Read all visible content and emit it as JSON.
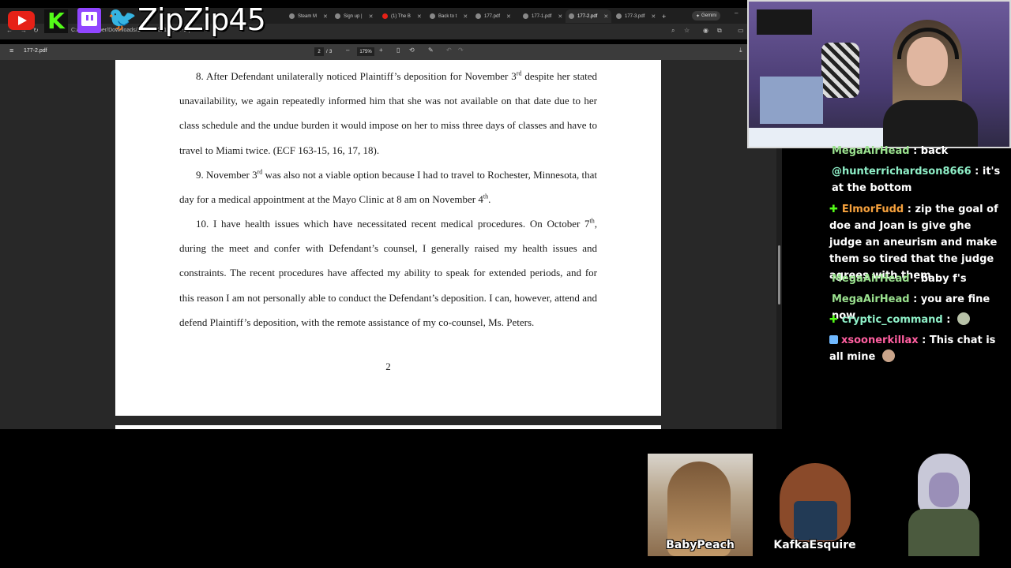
{
  "browser": {
    "tabs": [
      {
        "label": "Steam M"
      },
      {
        "label": "Sign up |"
      },
      {
        "label": "(1) The B"
      },
      {
        "label": "Back to t"
      },
      {
        "label": "177.pdf"
      },
      {
        "label": "177-1.pdf"
      },
      {
        "label": "177-2.pdf"
      },
      {
        "label": "177-3.pdf"
      }
    ],
    "new_tab": "+",
    "gemini_label": "Gemini",
    "url": "C:/Users/tober/Downloads/1-25-cv-201.../177-2.pdf"
  },
  "pdf": {
    "file_name": "177-2.pdf",
    "current_page": "2",
    "page_separator": "/",
    "total_pages": "3",
    "zoom": "175%",
    "zoom_minus": "–",
    "zoom_plus": "+",
    "page_number_footer": "2",
    "paragraphs": {
      "p8_a": "8.  After Defendant unilaterally noticed Plaintiff’s deposition for November 3",
      "p8_sup": "rd",
      "p8_b": " despite her stated unavailability, we again repeatedly informed him that she was not available on that date due to her class schedule and the undue burden it would impose on her to miss three days of classes and have to travel to Miami twice. (ECF 163-15, 16, 17, 18).",
      "p9_a": "9.  November 3",
      "p9_sup": "rd",
      "p9_b": " was also not a viable option because I had to travel to Rochester, Minnesota, that day for a medical appointment at the Mayo Clinic at 8 am on November 4",
      "p9_sup2": "th",
      "p9_c": ".",
      "p10_a": "10. I have health issues which have necessitated recent medical procedures. On October 7",
      "p10_sup": "th",
      "p10_b": ", during the meet and confer with Defendant’s counsel, I generally raised my health issues and constraints. The recent procedures have affected my ability to speak for extended periods, and for this reason I am not personally able to conduct the Defendant’s deposition. I can, however, attend and defend Plaintiff’s deposition, with the remote assistance of my co-counsel, Ms. Peters."
    }
  },
  "overlay": {
    "handle": "ZipZip45",
    "icons": [
      "youtube-icon",
      "kick-icon",
      "twitch-icon",
      "twitter-icon"
    ]
  },
  "chat": {
    "messages": [
      {
        "user": "MegaAirHead",
        "color": "#9be28f",
        "text": " : back"
      },
      {
        "user": "@hunterrichardson8666",
        "color": "#8ff0c8",
        "text": " : it's at the bottom"
      },
      {
        "user": "ElmorFudd",
        "color": "#f6a13d",
        "text": " : zip the goal of doe and Joan is give ghe judge an aneurism and make them so tired that the judge agrees with them"
      },
      {
        "user": "MegaAirHead",
        "color": "#9be28f",
        "text": " : baby f's"
      },
      {
        "user": "MegaAirHead",
        "color": "#9be28f",
        "text": " : you are fine now"
      },
      {
        "user": "cryptic_command",
        "color": "#8ff0c8",
        "text": " :"
      },
      {
        "user": "xsoonerkillax",
        "color": "#ff5fa0",
        "text": " : This chat is all mine"
      }
    ]
  },
  "avatars": [
    {
      "name": "BabyPeach"
    },
    {
      "name": "KafkaEsquire"
    }
  ]
}
